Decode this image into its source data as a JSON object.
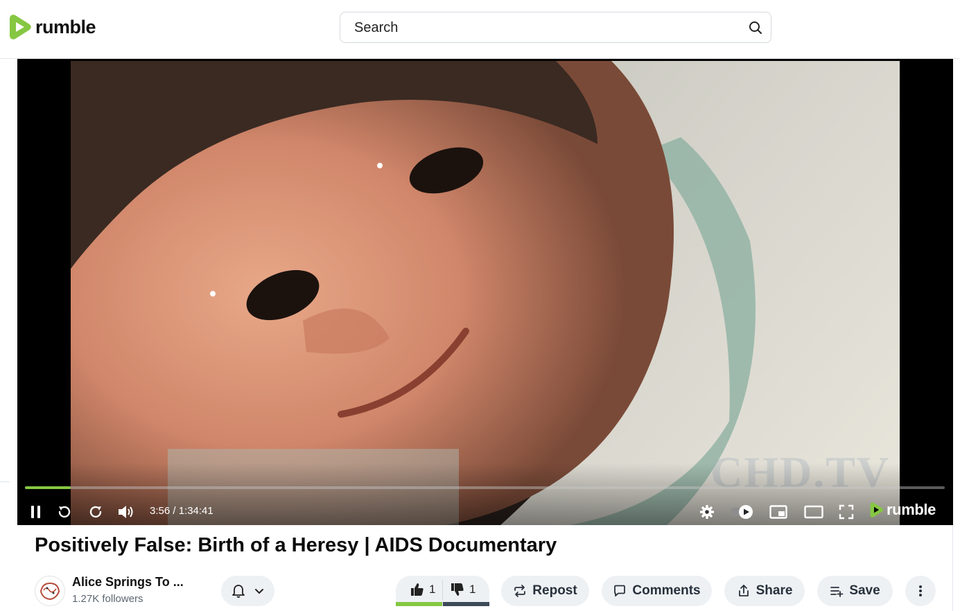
{
  "brand": {
    "name": "rumble",
    "accent": "#85c742"
  },
  "search": {
    "placeholder": "Search",
    "icon": "magnifier-icon"
  },
  "player": {
    "watermark": "CHD.TV",
    "time_display": "3:56 / 1:34:41",
    "progress_fraction": 0.05,
    "controls": [
      "pause-icon",
      "rewind-icon",
      "forward-icon",
      "volume-icon",
      "settings-icon",
      "autoplay-toggle",
      "miniplayer-icon",
      "theater-icon",
      "fullscreen-icon"
    ],
    "brand_text": "rumble"
  },
  "video": {
    "title": "Positively False: Birth of a Heresy | AIDS Documentary"
  },
  "channel": {
    "name": "Alice Springs To ...",
    "followers": "1.27K followers"
  },
  "actions": {
    "likes": "1",
    "dislikes": "1",
    "repost": "Repost",
    "comments": "Comments",
    "share": "Share",
    "save": "Save"
  }
}
